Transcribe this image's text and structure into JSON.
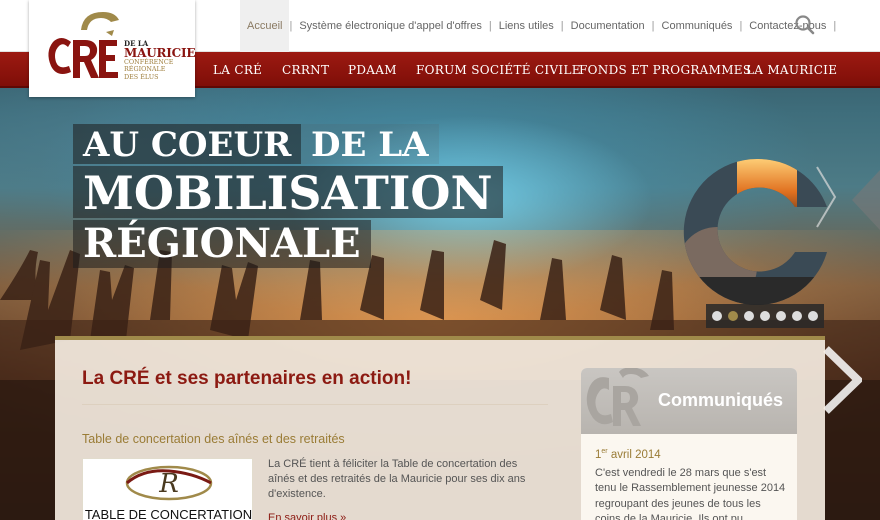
{
  "colors": {
    "brand_red": "#8c1a12",
    "brand_gold": "#a08a4a",
    "nav_bar": "#8a120b"
  },
  "logo": {
    "mark": "CRÉ",
    "de_la": "DE LA",
    "name": "MAURICIE",
    "line1": "CONFÉRENCE",
    "line2": "RÉGIONALE",
    "line3": "DES ÉLUS"
  },
  "topnav": {
    "items": [
      {
        "label": "Accueil",
        "active": true
      },
      {
        "label": "Système électronique d'appel d'offres"
      },
      {
        "label": "Liens utiles"
      },
      {
        "label": "Documentation"
      },
      {
        "label": "Communiqués"
      },
      {
        "label": "Contactez-nous"
      }
    ],
    "separator": "|",
    "search_icon": "search-icon"
  },
  "mainnav": {
    "items": [
      {
        "label": "LA CRÉ"
      },
      {
        "label": "CRRNT"
      },
      {
        "label": "PDAAM"
      },
      {
        "label": "FORUM SOCIÉTÉ CIVILE"
      },
      {
        "label": "FONDS ET PROGRAMMES"
      },
      {
        "label": "LA MAURICIE"
      }
    ]
  },
  "hero": {
    "line1_a": "AU COEUR",
    "line1_b": "DE LA",
    "line2": "MOBILISATION",
    "line3": "RÉGIONALE"
  },
  "slider": {
    "dots": 7,
    "active_index": 1
  },
  "content": {
    "section_title": "La CRÉ et ses partenaires en action!",
    "article": {
      "title": "Table de concertation des aînés et des retraités",
      "thumb_caption": "TABLE DE CONCERTATION",
      "body": "La CRÉ tient à féliciter la Table de concertation des aînés et des retraités de la Mauricie pour ses dix ans d'existence.",
      "read_more": "En savoir plus »"
    },
    "communiques": {
      "title": "Communiqués",
      "date_day": "1",
      "date_sup": "er",
      "date_rest": " avril 2014",
      "body": "C'est vendredi le 28 mars que s'est tenu le Rassemblement jeunesse 2014 regroupant des jeunes de tous les coins de la Mauricie. Ils ont pu"
    }
  }
}
